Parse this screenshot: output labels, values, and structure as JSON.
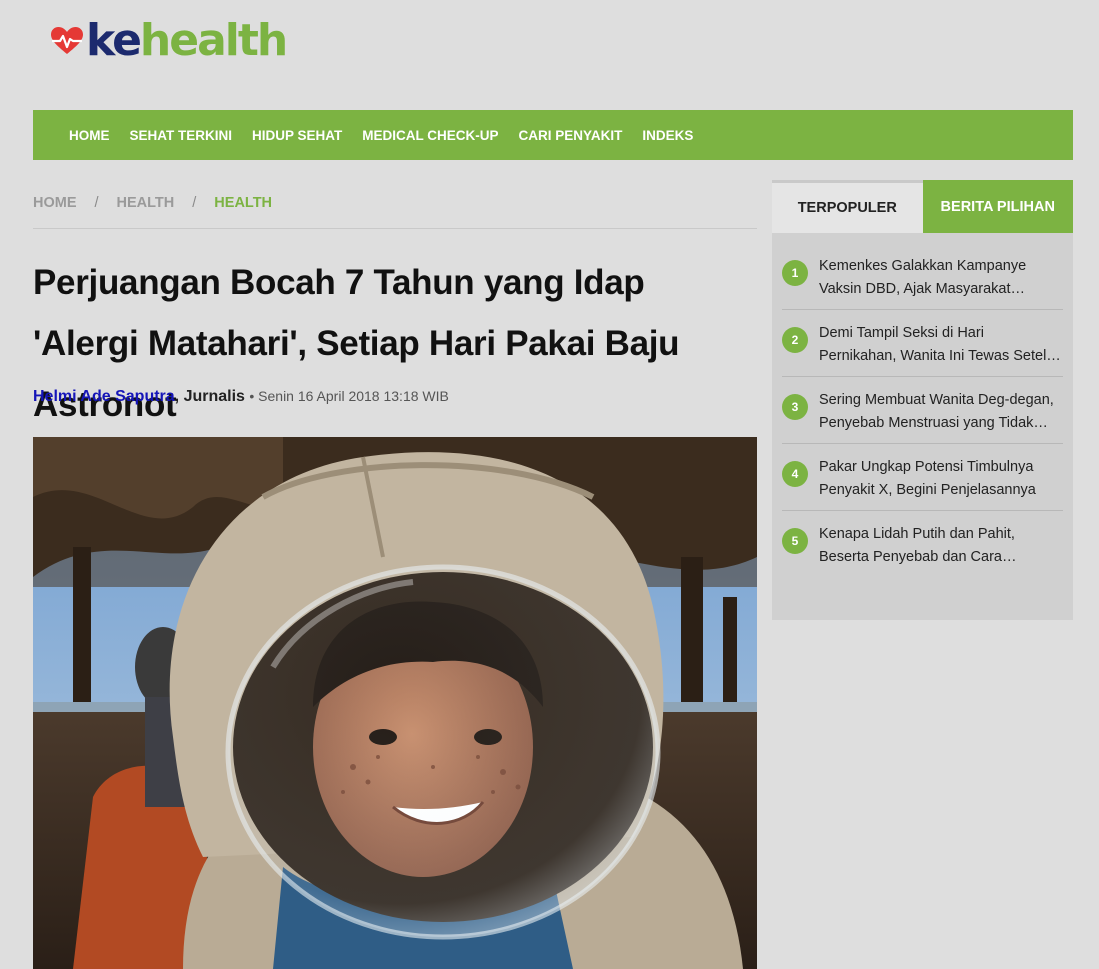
{
  "logo": {
    "part1": "ke",
    "part2": "health",
    "icon": "heart-pulse-icon"
  },
  "nav": {
    "items": [
      "HOME",
      "SEHAT TERKINI",
      "HIDUP SEHAT",
      "MEDICAL CHECK-UP",
      "CARI PENYAKIT",
      "INDEKS"
    ]
  },
  "breadcrumb": {
    "items": [
      "HOME",
      "HEALTH",
      "HEALTH"
    ],
    "separator": "/"
  },
  "article": {
    "title": "Perjuangan Bocah 7 Tahun yang Idap 'Alergi Matahari', Setiap Hari Pakai Baju Astronot",
    "author": "Helmi Ade Saputra",
    "role": ", Jurnalis",
    "date": "• Senin 16 April 2018 13:18 WIB"
  },
  "sidebar": {
    "tabs": [
      "TERPOPULER",
      "BERITA PILIHAN"
    ],
    "popular": [
      {
        "num": "1",
        "title": "Kemenkes Galakkan Kampanye Vaksin DBD, Ajak Masyarakat Lakukan Vaksinasi"
      },
      {
        "num": "2",
        "title": "Demi Tampil Seksi di Hari Pernikahan, Wanita Ini Tewas Setelah Sedot Lemak"
      },
      {
        "num": "3",
        "title": "Sering Membuat Wanita Deg-degan, Penyebab Menstruasi yang Tidak Teratur"
      },
      {
        "num": "4",
        "title": "Pakar Ungkap Potensi Timbulnya Penyakit X, Begini Penjelasannya"
      },
      {
        "num": "5",
        "title": "Kenapa Lidah Putih dan Pahit, Beserta Penyebab dan Cara Mengatasinya"
      }
    ]
  },
  "colors": {
    "brand_green": "#7cb342",
    "brand_navy": "#1c2a6e",
    "author_link": "#1515b8"
  }
}
